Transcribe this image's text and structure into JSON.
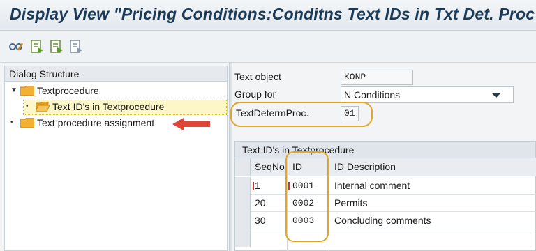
{
  "window": {
    "title": "Display View \"Pricing Conditions:Conditns Text IDs in Txt Det. Proc"
  },
  "toolbar": {
    "icons": [
      "glasses-icon",
      "copy-entries-icon",
      "save-icon",
      "deselect-icon"
    ]
  },
  "dialog_structure": {
    "header": "Dialog Structure",
    "items": [
      {
        "label": "Textprocedure",
        "level": 0,
        "expanded": true
      },
      {
        "label": "Text ID's in Textprocedure",
        "level": 1,
        "selected": true
      },
      {
        "label": "Text procedure assignment",
        "level": 0
      }
    ]
  },
  "fields": {
    "text_object": {
      "label": "Text object",
      "value": "KONP"
    },
    "group_for": {
      "label": "Group for",
      "value": "N Conditions"
    },
    "text_determ_proc": {
      "label": "TextDetermProc.",
      "value": "01"
    }
  },
  "table": {
    "title": "Text ID's in Textprocedure",
    "columns": [
      "SeqNo",
      "ID",
      "ID Description"
    ],
    "rows": [
      {
        "seqno": "1",
        "id": "0001",
        "description": "Internal comment"
      },
      {
        "seqno": "20",
        "id": "0002",
        "description": "Permits"
      },
      {
        "seqno": "30",
        "id": "0003",
        "description": "Concluding comments"
      }
    ]
  },
  "colors": {
    "highlight": "#e2a526",
    "arrow": "#e0453a",
    "title": "#1b3a57",
    "folder": "#f2b134"
  }
}
